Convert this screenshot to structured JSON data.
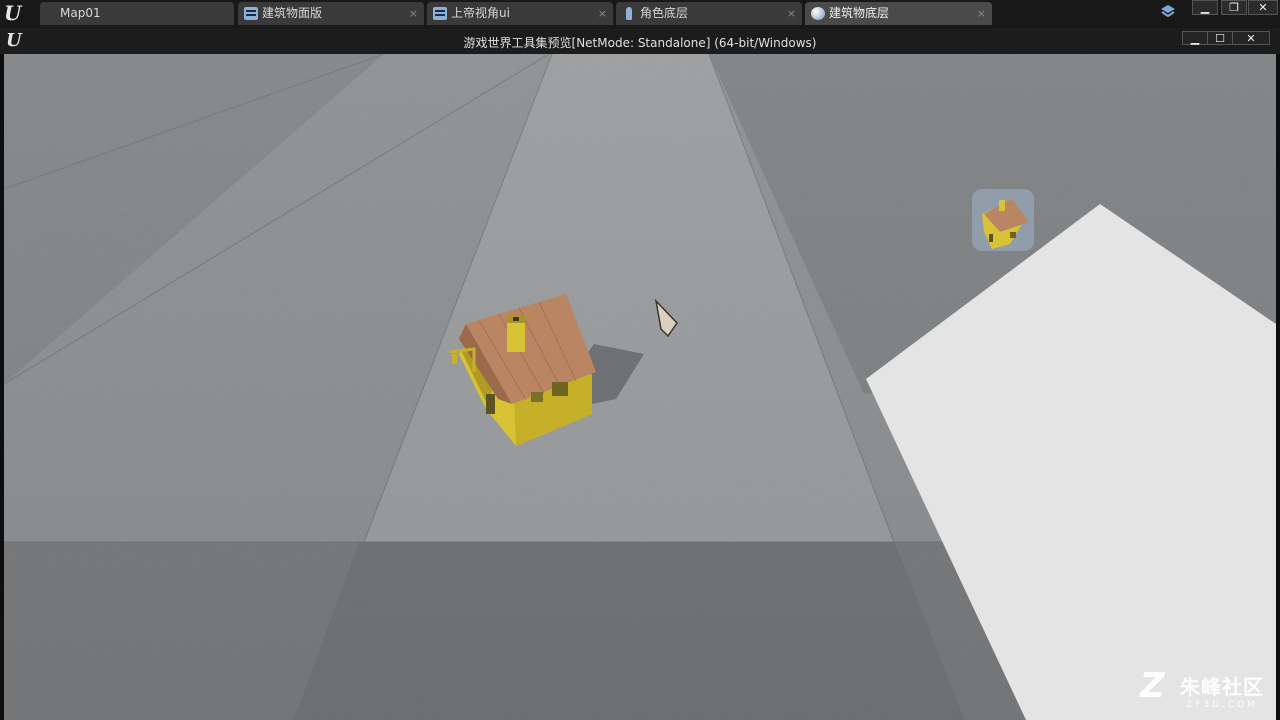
{
  "editor_tabs": [
    {
      "label": "Map01",
      "icon": "level-icon",
      "closable": false
    },
    {
      "label": "建筑物面版",
      "icon": "widget-blueprint-icon",
      "closable": true
    },
    {
      "label": "上帝视角ui",
      "icon": "widget-blueprint-icon",
      "closable": true
    },
    {
      "label": "角色底层",
      "icon": "character-blueprint-icon",
      "closable": true
    },
    {
      "label": "建筑物底层",
      "icon": "actor-blueprint-icon",
      "closable": true
    }
  ],
  "tab_close_glyph": "×",
  "window_controls": {
    "minimize": "▁",
    "restore": "❐",
    "maximize": "☐",
    "close": "✕"
  },
  "logo_letter": "U",
  "pie_window": {
    "title": "游戏世界工具集预览[NetMode: Standalone] (64-bit/Windows)"
  },
  "watermark": {
    "logo": "Z",
    "name_cn": "朱峰社区",
    "name_en": "ZF3D.COM"
  },
  "colors": {
    "tab_bar": "#181818",
    "tab_inactive": "#3a3a3a",
    "tab_active": "#4a4a4a",
    "floor_dark": "#7d8082",
    "floor_light": "#9a9c9e",
    "house_wall": "#d9c33a",
    "house_roof": "#b9835e",
    "placement_plane": "#e6e6e6"
  }
}
